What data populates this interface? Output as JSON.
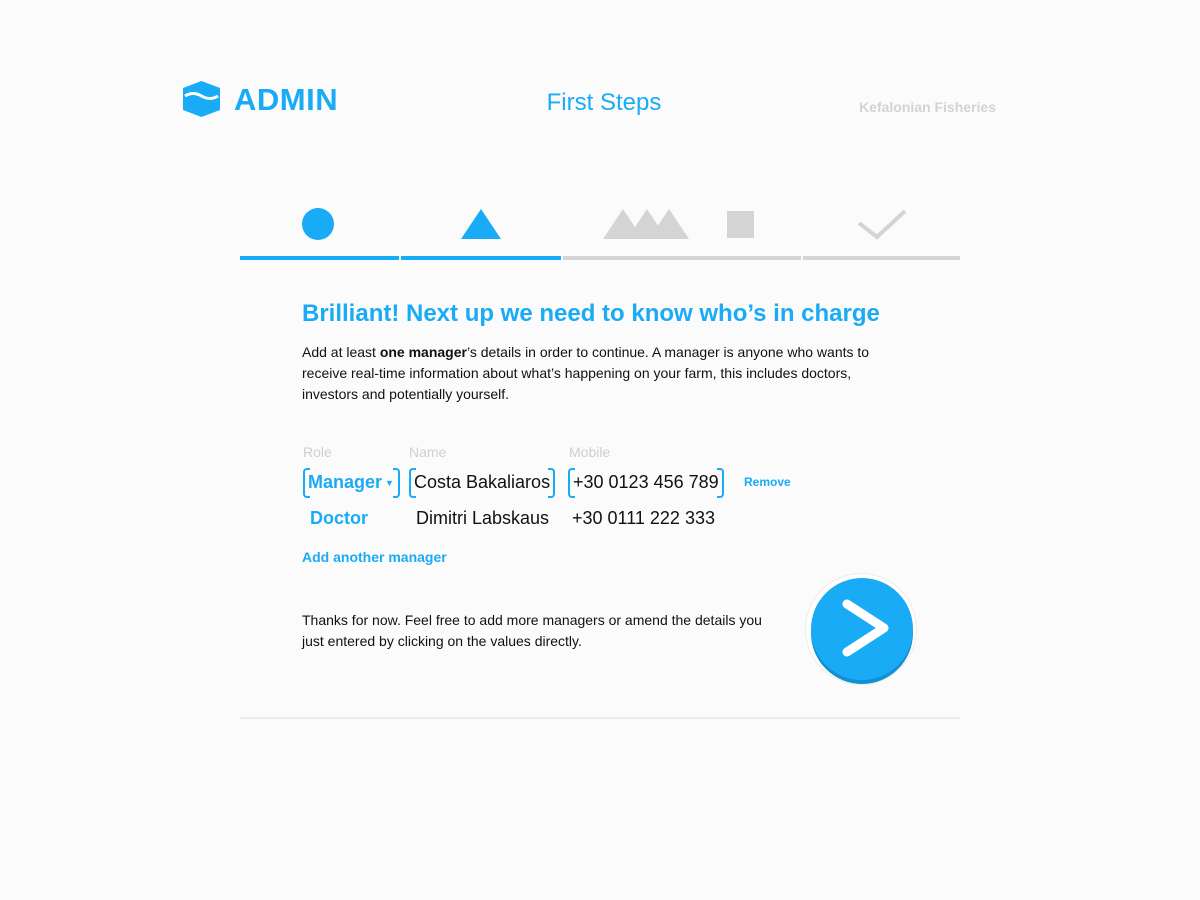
{
  "header": {
    "app_name": "ADMIN",
    "page_title": "First Steps",
    "organization": "Kefalonian Fisheries"
  },
  "stepper": {
    "steps": [
      {
        "icon": "circle-icon",
        "state": "complete"
      },
      {
        "icon": "triangle-icon",
        "state": "current"
      },
      {
        "icon": "mountains-icon",
        "state": "pending"
      },
      {
        "icon": "square-icon",
        "state": "pending"
      },
      {
        "icon": "checkmark-icon",
        "state": "pending"
      }
    ]
  },
  "main": {
    "heading": "Brilliant! Next up we need to know who’s in charge",
    "intro_prefix": "Add at least ",
    "intro_bold": "one manager",
    "intro_suffix": "’s details in order to continue. A manager is anyone who wants to receive real-time information about what’s happening on your farm, this includes doctors, investors and potentially yourself."
  },
  "managers_table": {
    "columns": [
      "Role",
      "Name",
      "Mobile"
    ],
    "rows": [
      {
        "role": "Manager",
        "name": "Costa Bakaliaros",
        "mobile": "+30 0123 456 789",
        "editing": true,
        "action": "Remove"
      },
      {
        "role": "Doctor",
        "name": "Dimitri Labskaus",
        "mobile": "+30 0111 222 333",
        "editing": false
      }
    ],
    "add_label": "Add another manager"
  },
  "footer": {
    "thanks_text": "Thanks for now. Feel free to add more managers or amend the details you just entered by clicking on the values directly.",
    "next_icon": "chevron-right-icon"
  },
  "colors": {
    "accent": "#1aabf6",
    "inactive": "#d4d4d4",
    "muted_text": "#cfcfcf"
  }
}
